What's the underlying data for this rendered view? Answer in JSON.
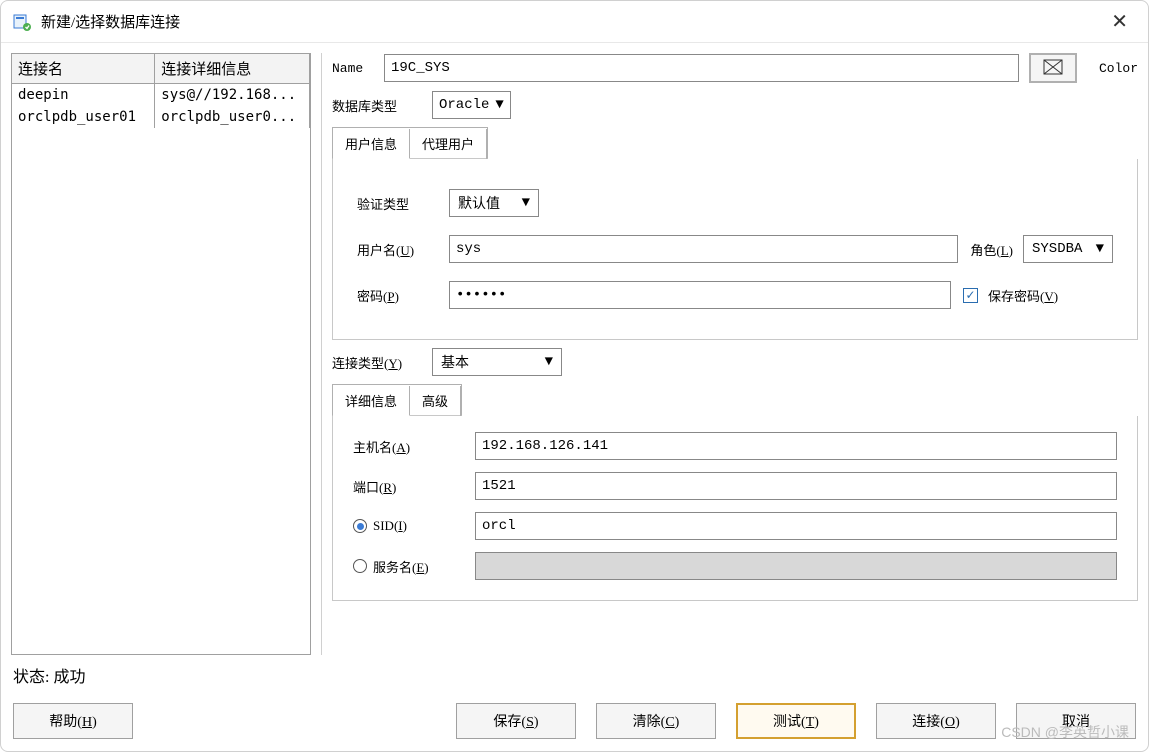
{
  "window": {
    "title": "新建/选择数据库连接",
    "close_tooltip": "关闭"
  },
  "connections": {
    "headers": [
      "连接名",
      "连接详细信息"
    ],
    "rows": [
      {
        "name": "deepin",
        "detail": "sys@//192.168..."
      },
      {
        "name": "orclpdb_user01",
        "detail": "orclpdb_user0..."
      }
    ]
  },
  "form": {
    "name_label": "Name",
    "name_value": "19C_SYS",
    "color_label": "Color",
    "dbtype_label": "数据库类型",
    "dbtype_value": "Oracle",
    "tabs": {
      "userinfo": "用户信息",
      "proxy": "代理用户"
    },
    "authtype_label": "验证类型",
    "authtype_value": "默认值",
    "username_label": "用户名(U)",
    "username_value": "sys",
    "role_label": "角色(L)",
    "role_value": "SYSDBA",
    "password_label": "密码(P)",
    "password_value": "••••••",
    "savepw_label": "保存密码(V)",
    "conntype_label": "连接类型(Y)",
    "conntype_value": "基本",
    "detail_tabs": {
      "detail": "详细信息",
      "advanced": "高级"
    },
    "host_label": "主机名(A)",
    "host_value": "192.168.126.141",
    "port_label": "端口(R)",
    "port_value": "1521",
    "sid_label": "SID(I)",
    "sid_value": "orcl",
    "service_label": "服务名(E)",
    "service_value": ""
  },
  "status": {
    "label": "状态:",
    "value": "成功"
  },
  "buttons": {
    "help": "帮助(H)",
    "save": "保存(S)",
    "clear": "清除(C)",
    "test": "测试(T)",
    "connect": "连接(O)",
    "cancel": "取消"
  },
  "watermark": "CSDN @李英哲小课"
}
